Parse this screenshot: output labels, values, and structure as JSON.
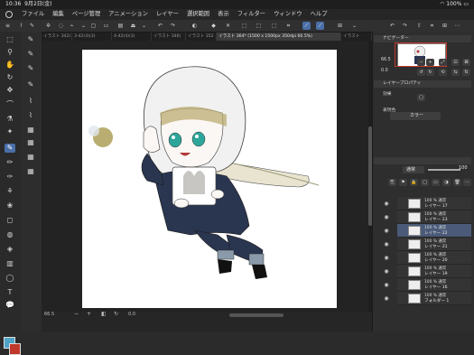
{
  "status": {
    "time": "10:36",
    "date": "9月2日(金)",
    "battery": "100%"
  },
  "menu": {
    "items": [
      "ファイル",
      "編集",
      "ページ管理",
      "アニメーション",
      "レイヤー",
      "選択範囲",
      "表示",
      "フィルター",
      "ウィンドウ",
      "ヘルプ"
    ]
  },
  "tabs": [
    {
      "label": "イラスト 342(",
      "active": false
    },
    {
      "label": "3-42(4)(3)",
      "active": false
    },
    {
      "label": "4-42(4)(3)",
      "active": false
    },
    {
      "label": "イラスト 346(",
      "active": false
    },
    {
      "label": "イラスト 352",
      "active": false
    },
    {
      "label": "イラスト 364* (1500 x 1500px 350dpi 66.5%)",
      "active": true
    },
    {
      "label": "イラスト",
      "active": false
    }
  ],
  "canvas": {
    "zoom": "66.5",
    "angle": "0.0"
  },
  "navigator": {
    "title": "ナビゲーター",
    "zoom": "66.5",
    "angle": "0.0"
  },
  "layer_property": {
    "title": "レイヤープロパティ",
    "effect_label": "効果",
    "expression_label": "表現色",
    "expression_value": "カラー"
  },
  "layers_panel": {
    "blend_mode": "通常",
    "opacity": "100"
  },
  "layers": [
    {
      "opacity": "100 %",
      "mode": "通常",
      "name": "レイヤー 17",
      "selected": false
    },
    {
      "opacity": "100 %",
      "mode": "通常",
      "name": "レイヤー 23",
      "selected": false
    },
    {
      "opacity": "100 %",
      "mode": "通常",
      "name": "レイヤー 22",
      "selected": true
    },
    {
      "opacity": "100 %",
      "mode": "通常",
      "name": "レイヤー 21",
      "selected": false
    },
    {
      "opacity": "100 %",
      "mode": "通常",
      "name": "レイヤー 20",
      "selected": false
    },
    {
      "opacity": "100 %",
      "mode": "通常",
      "name": "レイヤー 19",
      "selected": false
    },
    {
      "opacity": "100 %",
      "mode": "通常",
      "name": "レイヤー 16",
      "selected": false
    },
    {
      "opacity": "100 %",
      "mode": "通常",
      "name": "フォルダー 1",
      "selected": false
    }
  ],
  "colors": {
    "accent": "#4a6fa8",
    "main_color": "#4fa3c7",
    "sub_color": "#c0392b"
  }
}
